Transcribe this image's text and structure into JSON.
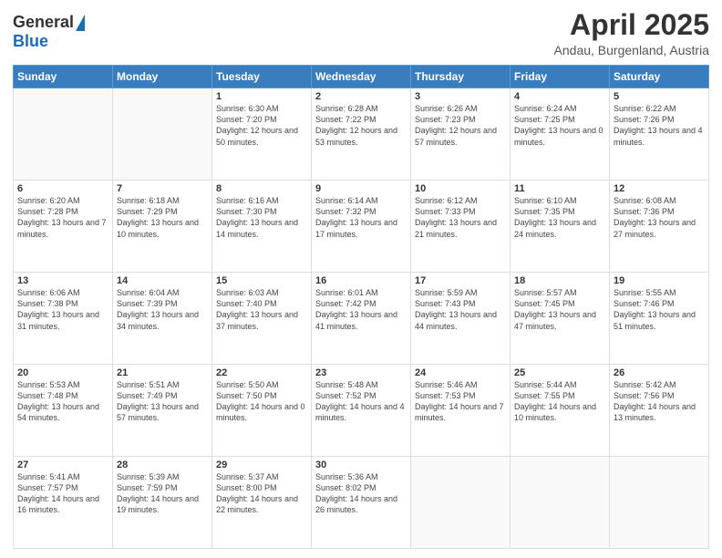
{
  "logo": {
    "general": "General",
    "blue": "Blue"
  },
  "title": "April 2025",
  "subtitle": "Andau, Burgenland, Austria",
  "header_days": [
    "Sunday",
    "Monday",
    "Tuesday",
    "Wednesday",
    "Thursday",
    "Friday",
    "Saturday"
  ],
  "weeks": [
    [
      {
        "day": "",
        "info": ""
      },
      {
        "day": "",
        "info": ""
      },
      {
        "day": "1",
        "info": "Sunrise: 6:30 AM\nSunset: 7:20 PM\nDaylight: 12 hours and 50 minutes."
      },
      {
        "day": "2",
        "info": "Sunrise: 6:28 AM\nSunset: 7:22 PM\nDaylight: 12 hours and 53 minutes."
      },
      {
        "day": "3",
        "info": "Sunrise: 6:26 AM\nSunset: 7:23 PM\nDaylight: 12 hours and 57 minutes."
      },
      {
        "day": "4",
        "info": "Sunrise: 6:24 AM\nSunset: 7:25 PM\nDaylight: 13 hours and 0 minutes."
      },
      {
        "day": "5",
        "info": "Sunrise: 6:22 AM\nSunset: 7:26 PM\nDaylight: 13 hours and 4 minutes."
      }
    ],
    [
      {
        "day": "6",
        "info": "Sunrise: 6:20 AM\nSunset: 7:28 PM\nDaylight: 13 hours and 7 minutes."
      },
      {
        "day": "7",
        "info": "Sunrise: 6:18 AM\nSunset: 7:29 PM\nDaylight: 13 hours and 10 minutes."
      },
      {
        "day": "8",
        "info": "Sunrise: 6:16 AM\nSunset: 7:30 PM\nDaylight: 13 hours and 14 minutes."
      },
      {
        "day": "9",
        "info": "Sunrise: 6:14 AM\nSunset: 7:32 PM\nDaylight: 13 hours and 17 minutes."
      },
      {
        "day": "10",
        "info": "Sunrise: 6:12 AM\nSunset: 7:33 PM\nDaylight: 13 hours and 21 minutes."
      },
      {
        "day": "11",
        "info": "Sunrise: 6:10 AM\nSunset: 7:35 PM\nDaylight: 13 hours and 24 minutes."
      },
      {
        "day": "12",
        "info": "Sunrise: 6:08 AM\nSunset: 7:36 PM\nDaylight: 13 hours and 27 minutes."
      }
    ],
    [
      {
        "day": "13",
        "info": "Sunrise: 6:06 AM\nSunset: 7:38 PM\nDaylight: 13 hours and 31 minutes."
      },
      {
        "day": "14",
        "info": "Sunrise: 6:04 AM\nSunset: 7:39 PM\nDaylight: 13 hours and 34 minutes."
      },
      {
        "day": "15",
        "info": "Sunrise: 6:03 AM\nSunset: 7:40 PM\nDaylight: 13 hours and 37 minutes."
      },
      {
        "day": "16",
        "info": "Sunrise: 6:01 AM\nSunset: 7:42 PM\nDaylight: 13 hours and 41 minutes."
      },
      {
        "day": "17",
        "info": "Sunrise: 5:59 AM\nSunset: 7:43 PM\nDaylight: 13 hours and 44 minutes."
      },
      {
        "day": "18",
        "info": "Sunrise: 5:57 AM\nSunset: 7:45 PM\nDaylight: 13 hours and 47 minutes."
      },
      {
        "day": "19",
        "info": "Sunrise: 5:55 AM\nSunset: 7:46 PM\nDaylight: 13 hours and 51 minutes."
      }
    ],
    [
      {
        "day": "20",
        "info": "Sunrise: 5:53 AM\nSunset: 7:48 PM\nDaylight: 13 hours and 54 minutes."
      },
      {
        "day": "21",
        "info": "Sunrise: 5:51 AM\nSunset: 7:49 PM\nDaylight: 13 hours and 57 minutes."
      },
      {
        "day": "22",
        "info": "Sunrise: 5:50 AM\nSunset: 7:50 PM\nDaylight: 14 hours and 0 minutes."
      },
      {
        "day": "23",
        "info": "Sunrise: 5:48 AM\nSunset: 7:52 PM\nDaylight: 14 hours and 4 minutes."
      },
      {
        "day": "24",
        "info": "Sunrise: 5:46 AM\nSunset: 7:53 PM\nDaylight: 14 hours and 7 minutes."
      },
      {
        "day": "25",
        "info": "Sunrise: 5:44 AM\nSunset: 7:55 PM\nDaylight: 14 hours and 10 minutes."
      },
      {
        "day": "26",
        "info": "Sunrise: 5:42 AM\nSunset: 7:56 PM\nDaylight: 14 hours and 13 minutes."
      }
    ],
    [
      {
        "day": "27",
        "info": "Sunrise: 5:41 AM\nSunset: 7:57 PM\nDaylight: 14 hours and 16 minutes."
      },
      {
        "day": "28",
        "info": "Sunrise: 5:39 AM\nSunset: 7:59 PM\nDaylight: 14 hours and 19 minutes."
      },
      {
        "day": "29",
        "info": "Sunrise: 5:37 AM\nSunset: 8:00 PM\nDaylight: 14 hours and 22 minutes."
      },
      {
        "day": "30",
        "info": "Sunrise: 5:36 AM\nSunset: 8:02 PM\nDaylight: 14 hours and 26 minutes."
      },
      {
        "day": "",
        "info": ""
      },
      {
        "day": "",
        "info": ""
      },
      {
        "day": "",
        "info": ""
      }
    ]
  ]
}
